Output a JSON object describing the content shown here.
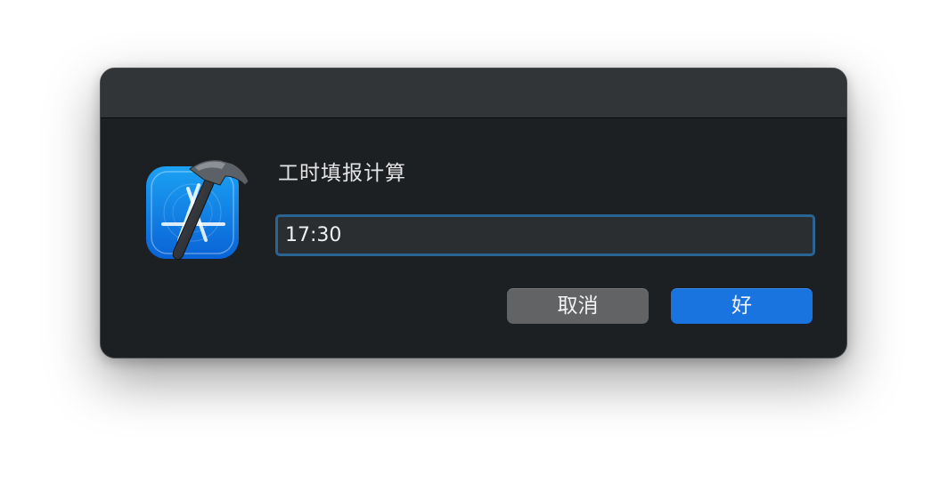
{
  "dialog": {
    "title": "工时填报计算",
    "input_value": "17:30",
    "app_icon": "xcode-hammer-icon"
  },
  "buttons": {
    "cancel_label": "取消",
    "ok_label": "好"
  },
  "colors": {
    "accent": "#1a74df",
    "focus_ring": "#2a6494",
    "dialog_bg": "#1d2023",
    "titlebar_bg": "#323537"
  }
}
